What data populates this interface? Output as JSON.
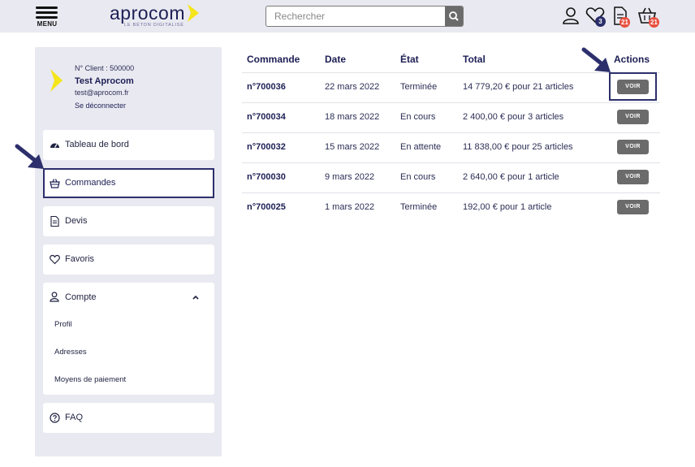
{
  "header": {
    "menu_label": "MENU",
    "logo_text": "aprocom",
    "logo_tagline": "LE BÉTON DIGITALISÉ",
    "search_placeholder": "Rechercher",
    "favorites_badge": "3",
    "quotes_badge": "21",
    "cart_badge": "21"
  },
  "client": {
    "number": "N° Client : 500000",
    "name": "Test Aprocom",
    "email": "test@aprocom.fr",
    "logout": "Se déconnecter"
  },
  "sidebar": {
    "dashboard": "Tableau de bord",
    "orders": "Commandes",
    "quotes": "Devis",
    "favorites": "Favoris",
    "account": "Compte",
    "account_items": [
      "Profil",
      "Adresses",
      "Moyens de paiement"
    ],
    "faq": "FAQ"
  },
  "orders_table": {
    "columns": [
      "Commande",
      "Date",
      "État",
      "Total",
      "Actions"
    ],
    "view_label": "VOIR",
    "rows": [
      {
        "id": "n°700036",
        "date": "22 mars 2022",
        "status": "Terminée",
        "total": "14 779,20 € pour 21 articles"
      },
      {
        "id": "n°700034",
        "date": "18 mars 2022",
        "status": "En cours",
        "total": "2 400,00 € pour 3 articles"
      },
      {
        "id": "n°700032",
        "date": "15 mars 2022",
        "status": "En attente",
        "total": "11 838,00 € pour 25 articles"
      },
      {
        "id": "n°700030",
        "date": "9 mars 2022",
        "status": "En cours",
        "total": "2 640,00 € pour 1 article"
      },
      {
        "id": "n°700025",
        "date": "1 mars 2022",
        "status": "Terminée",
        "total": "192,00 € pour 1 article"
      }
    ]
  },
  "colors": {
    "navy": "#1c1f54",
    "accent_yellow": "#f5e51b",
    "badge_navy": "#2a2d6a",
    "badge_red": "#e8503f",
    "button_gray": "#6b6b6b",
    "panel_bg": "#e9e9f1"
  },
  "icons": [
    "menu-icon",
    "search-icon",
    "user-icon",
    "heart-icon",
    "document-icon",
    "basket-icon",
    "dashboard-icon",
    "chevron-up-icon",
    "help-icon",
    "arrow-annotation-icon"
  ]
}
